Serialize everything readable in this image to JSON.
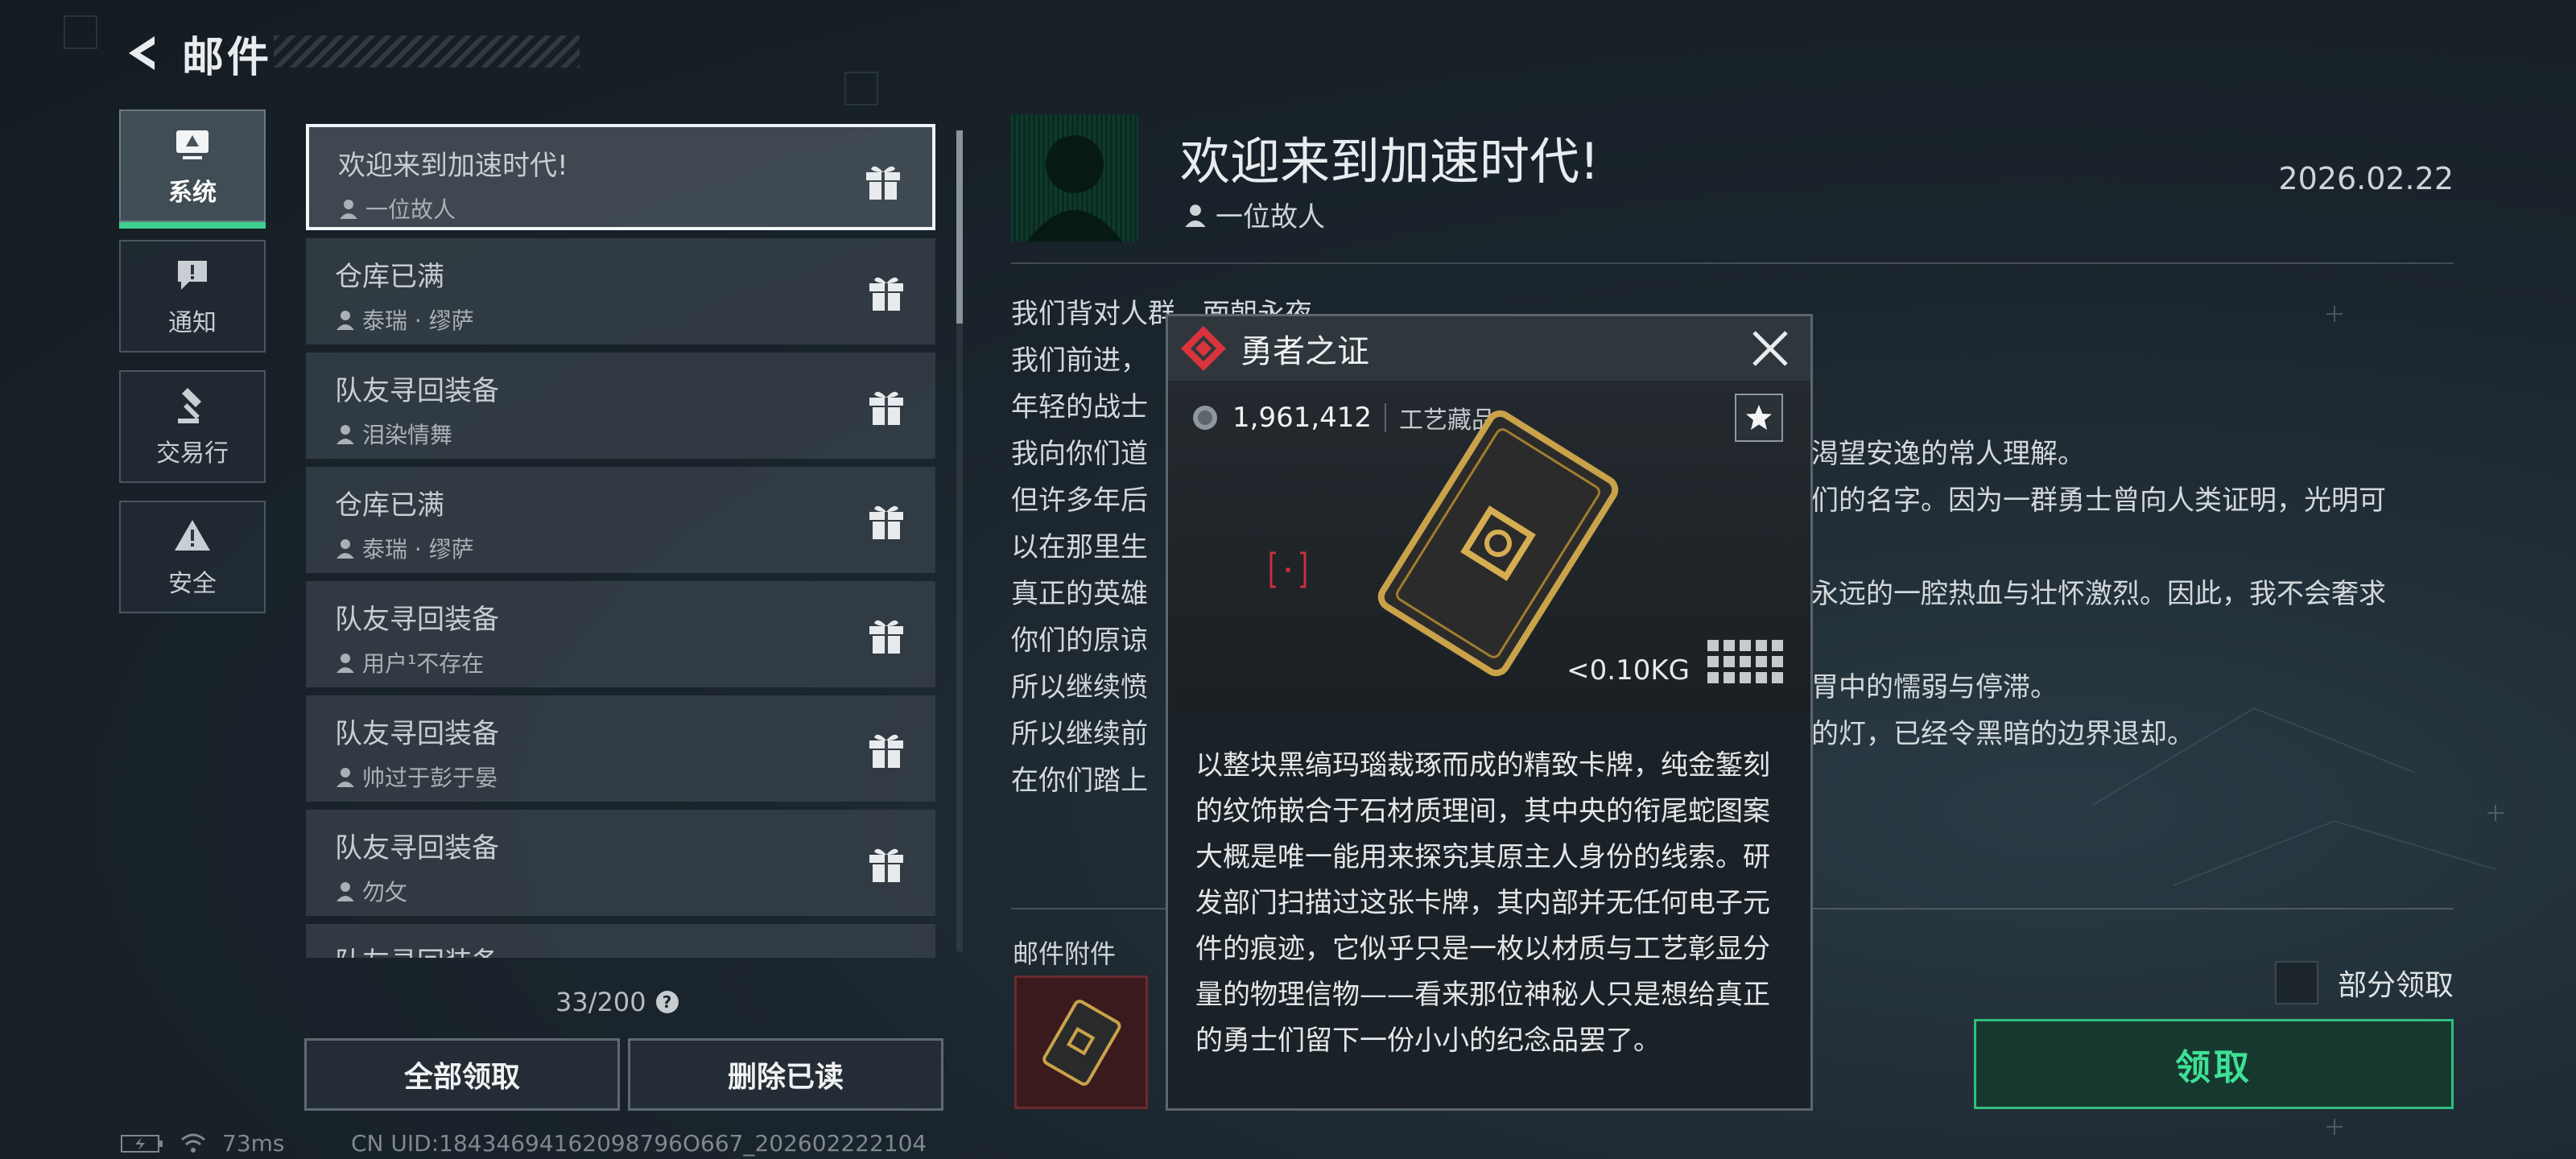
{
  "header": {
    "title": "邮件"
  },
  "categories": [
    {
      "label": "系统",
      "icon": "monitor-icon",
      "active": true
    },
    {
      "label": "通知",
      "icon": "alert-message-icon"
    },
    {
      "label": "交易行",
      "icon": "gavel-icon"
    },
    {
      "label": "安全",
      "icon": "warning-triangle-icon"
    }
  ],
  "mail_list": [
    {
      "title": "欢迎来到加速时代!",
      "sender": "一位故人",
      "selected": true
    },
    {
      "title": "仓库已满",
      "sender": "泰瑞 · 缪萨"
    },
    {
      "title": "队友寻回装备",
      "sender": "泪染情舞"
    },
    {
      "title": "仓库已满",
      "sender": "泰瑞 · 缪萨"
    },
    {
      "title": "队友寻回装备",
      "sender": "用户¹不存在"
    },
    {
      "title": "队友寻回装备",
      "sender": "帅过于彭于晏"
    },
    {
      "title": "队友寻回装备",
      "sender": "勿攵"
    },
    {
      "title": "队友寻回装备",
      "sender": ""
    }
  ],
  "mail_count": "33/200",
  "help_glyph": "?",
  "buttons": {
    "claim_all": "全部领取",
    "delete_read": "删除已读"
  },
  "status": {
    "ping": "73ms",
    "uid": "CN UID:18434694162098796O667_202602222104"
  },
  "mail": {
    "title": "欢迎来到加速时代!",
    "sender": "一位故人",
    "date": "2026.02.22",
    "body_lines": [
      "我们背对人群，面朝永夜",
      "我们前进，",
      "年轻的战士",
      "我向你们道",
      "但许多年后",
      "以在那里生",
      "真正的英雄",
      "你们的原谅",
      "所以继续愤",
      "所以继续前",
      "在你们踏上"
    ],
    "body_right_fragments": [
      {
        "line": 3,
        "text": "渴望安逸的常人理解。"
      },
      {
        "line": 4,
        "text": "们的名字。因为一群勇士曾向人类证明，光明可"
      },
      {
        "line": 6,
        "text": "永远的一腔热血与壮怀激烈。因此，我不会奢求"
      },
      {
        "line": 8,
        "text": "胃中的懦弱与停滞。"
      },
      {
        "line": 9,
        "text": "的灯，已经令黑暗的边界退却。"
      }
    ],
    "attachments_label": "邮件附件",
    "partial_claim_label": "部分领取",
    "claim_label": "领取"
  },
  "popup": {
    "title": "勇者之证",
    "value": "1,961,412",
    "category": "工艺藏品",
    "weight": "<0.10KG",
    "description": "以整块黑缟玛瑙裁琢而成的精致卡牌，纯金錾刻的纹饰嵌合于石材质理间，其中央的衔尾蛇图案大概是唯一能用来探究其原主人身份的线索。研发部门扫描过这张卡牌，其内部并无任何电子元件的痕迹，它似乎只是一枚以材质与工艺彰显分量的物理信物——看来那位神秘人只是想给真正的勇士们留下一份小小的纪念品罢了。"
  },
  "colors": {
    "accent_green": "#3ecf8e",
    "popup_icon_red": "#d9343c",
    "card_gold": "#c9a24a"
  }
}
